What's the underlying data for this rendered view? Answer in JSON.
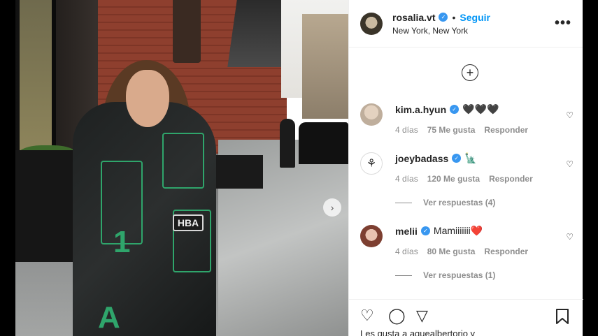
{
  "post": {
    "username": "rosalia.vt",
    "follow_label": "Seguir",
    "location": "New York, New York",
    "more_label": "•••",
    "load_more_label": "+",
    "photo_text": {
      "patch": "HBA",
      "number": "1",
      "letter": "A"
    },
    "next_label": "›"
  },
  "comments": [
    {
      "username": "kim.a.hyun",
      "text": "🖤🖤🖤",
      "age": "4 días",
      "likes": "75 Me gusta",
      "reply": "Responder",
      "view_replies": ""
    },
    {
      "username": "joeybadass",
      "text": "🗽",
      "age": "4 días",
      "likes": "120 Me gusta",
      "reply": "Responder",
      "view_replies": "Ver respuestas (4)"
    },
    {
      "username": "melii",
      "text": "Mamiiiiiii❤️",
      "age": "4 días",
      "likes": "80 Me gusta",
      "reply": "Responder",
      "view_replies": "Ver respuestas (1)"
    }
  ],
  "footer": {
    "liked_by": "Les gusta a aquealbertorio y"
  },
  "colors": {
    "accent": "#0095f6",
    "verified": "#3897f0",
    "meta": "#8e8e8e"
  }
}
